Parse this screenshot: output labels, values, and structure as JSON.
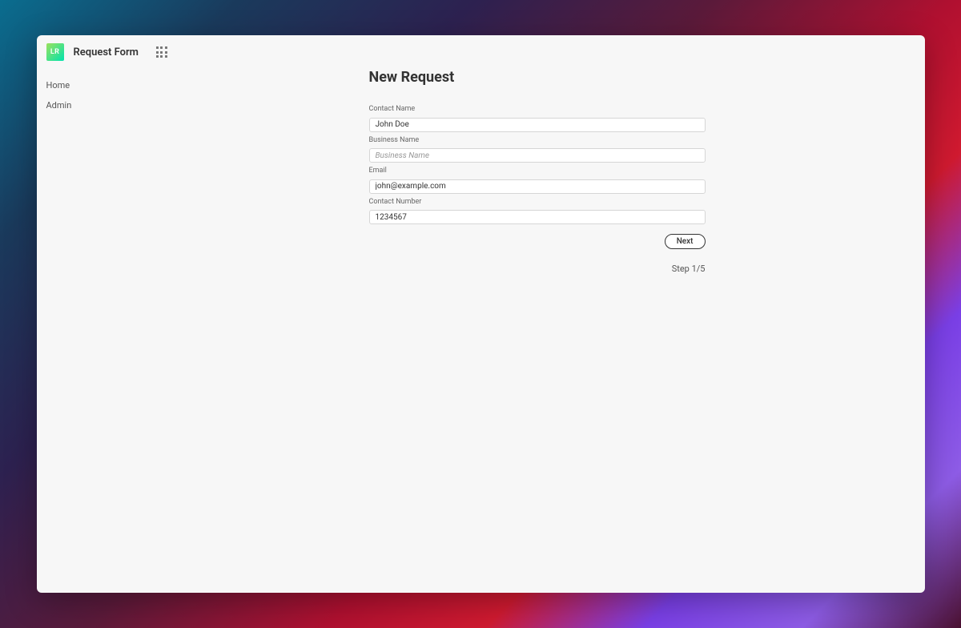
{
  "header": {
    "app_icon_text": "LR",
    "app_title": "Request Form"
  },
  "sidebar": {
    "items": [
      {
        "label": "Home"
      },
      {
        "label": "Admin"
      }
    ]
  },
  "main": {
    "page_title": "New Request",
    "form": {
      "contact_name": {
        "label": "Contact Name",
        "value": "John Doe"
      },
      "business_name": {
        "label": "Business Name",
        "placeholder": "Business Name",
        "value": ""
      },
      "email": {
        "label": "Email",
        "value": "john@example.com"
      },
      "contact_number": {
        "label": "Contact Number",
        "value": "1234567"
      }
    },
    "next_button_label": "Next",
    "step_indicator": "Step 1/5"
  }
}
